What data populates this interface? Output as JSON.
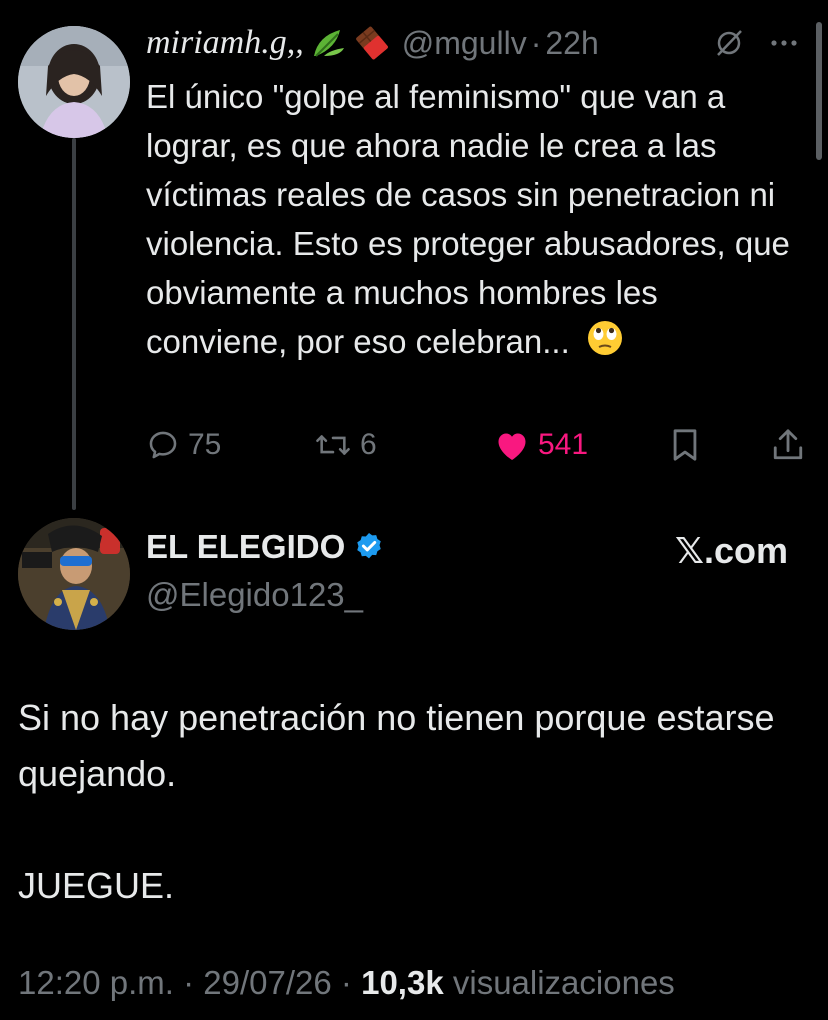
{
  "tweet1": {
    "author_name": "miriamh.g,,",
    "author_emojis": [
      "leaf-emoji",
      "chocolate-emoji"
    ],
    "handle": "@mgullv",
    "time": "22h",
    "separator": "·",
    "text": "El único \"golpe al feminismo\" que van a lograr, es que ahora nadie le crea a las víctimas reales de casos sin penetracion ni violencia. Esto es proteger abusadores, que obviamente a muchos hombres les conviene, por eso celebran...",
    "text_emoji": "face-with-rolling-eyes-emoji",
    "replies": "75",
    "retweets": "6",
    "likes": "541",
    "liked": true
  },
  "tweet2": {
    "author_name": "EL ELEGIDO",
    "verified": true,
    "handle": "@Elegido123_",
    "brand": "𝕏.com",
    "paragraph1": "Si no hay penetración no tienen porque estarse quejando.",
    "paragraph2": "JUEGUE."
  },
  "meta": {
    "time": "12:20 p.m.",
    "date": "29/07/26",
    "separator": "·",
    "views_count": "10,3k",
    "views_label": "visualizaciones"
  },
  "colors": {
    "background": "#000000",
    "text_primary": "#e7e9ea",
    "text_secondary": "#71767b",
    "like_pink": "#f91880",
    "verified_blue": "#1d9bf0"
  }
}
